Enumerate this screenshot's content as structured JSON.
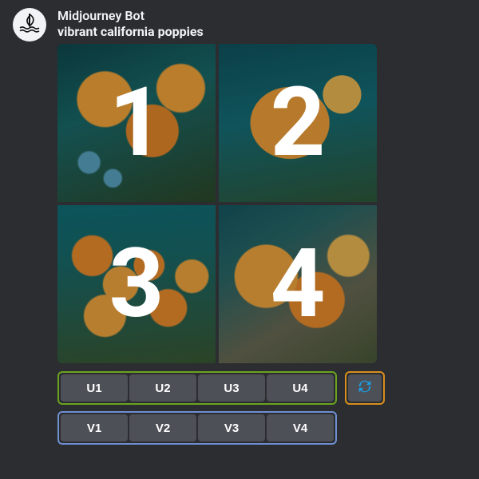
{
  "author": {
    "name": "Midjourney Bot"
  },
  "prompt": "vibrant california poppies",
  "grid": {
    "tiles": [
      "1",
      "2",
      "3",
      "4"
    ]
  },
  "buttons": {
    "upscale": [
      "U1",
      "U2",
      "U3",
      "U4"
    ],
    "variation": [
      "V1",
      "V2",
      "V3",
      "V4"
    ],
    "reroll_icon": "reroll"
  },
  "colors": {
    "upscale_outline": "#6aa31f",
    "variation_outline": "#6f8fd1",
    "reroll_outline": "#d98e1e",
    "button_bg": "#4e5058",
    "reroll_icon_color": "#1a9fe3"
  }
}
